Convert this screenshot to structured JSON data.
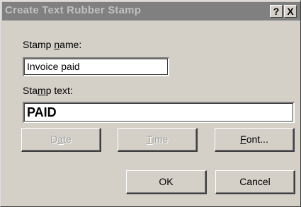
{
  "dialog": {
    "title": "Create Text Rubber Stamp",
    "help_label": "?",
    "close_label": "X"
  },
  "stamp_name": {
    "label_pre": "Stamp ",
    "label_key": "n",
    "label_post": "ame:",
    "value": "Invoice paid"
  },
  "stamp_text": {
    "label_pre": "Sta",
    "label_key": "m",
    "label_post": "p text:",
    "value": "PAID"
  },
  "buttons": {
    "date": {
      "pre": "D",
      "key": "a",
      "post": "te",
      "enabled": false
    },
    "time": {
      "pre": "",
      "key": "T",
      "post": "ime",
      "enabled": false
    },
    "font": {
      "pre": "",
      "key": "F",
      "post": "ont...",
      "enabled": true
    },
    "ok": {
      "label": "OK"
    },
    "cancel": {
      "label": "Cancel"
    }
  },
  "colors": {
    "dialog_face": "#d4d0c8",
    "titlebar_inactive": "#808080",
    "title_text_inactive": "#c0c0c0",
    "disabled_text": "#a0a0a0"
  }
}
